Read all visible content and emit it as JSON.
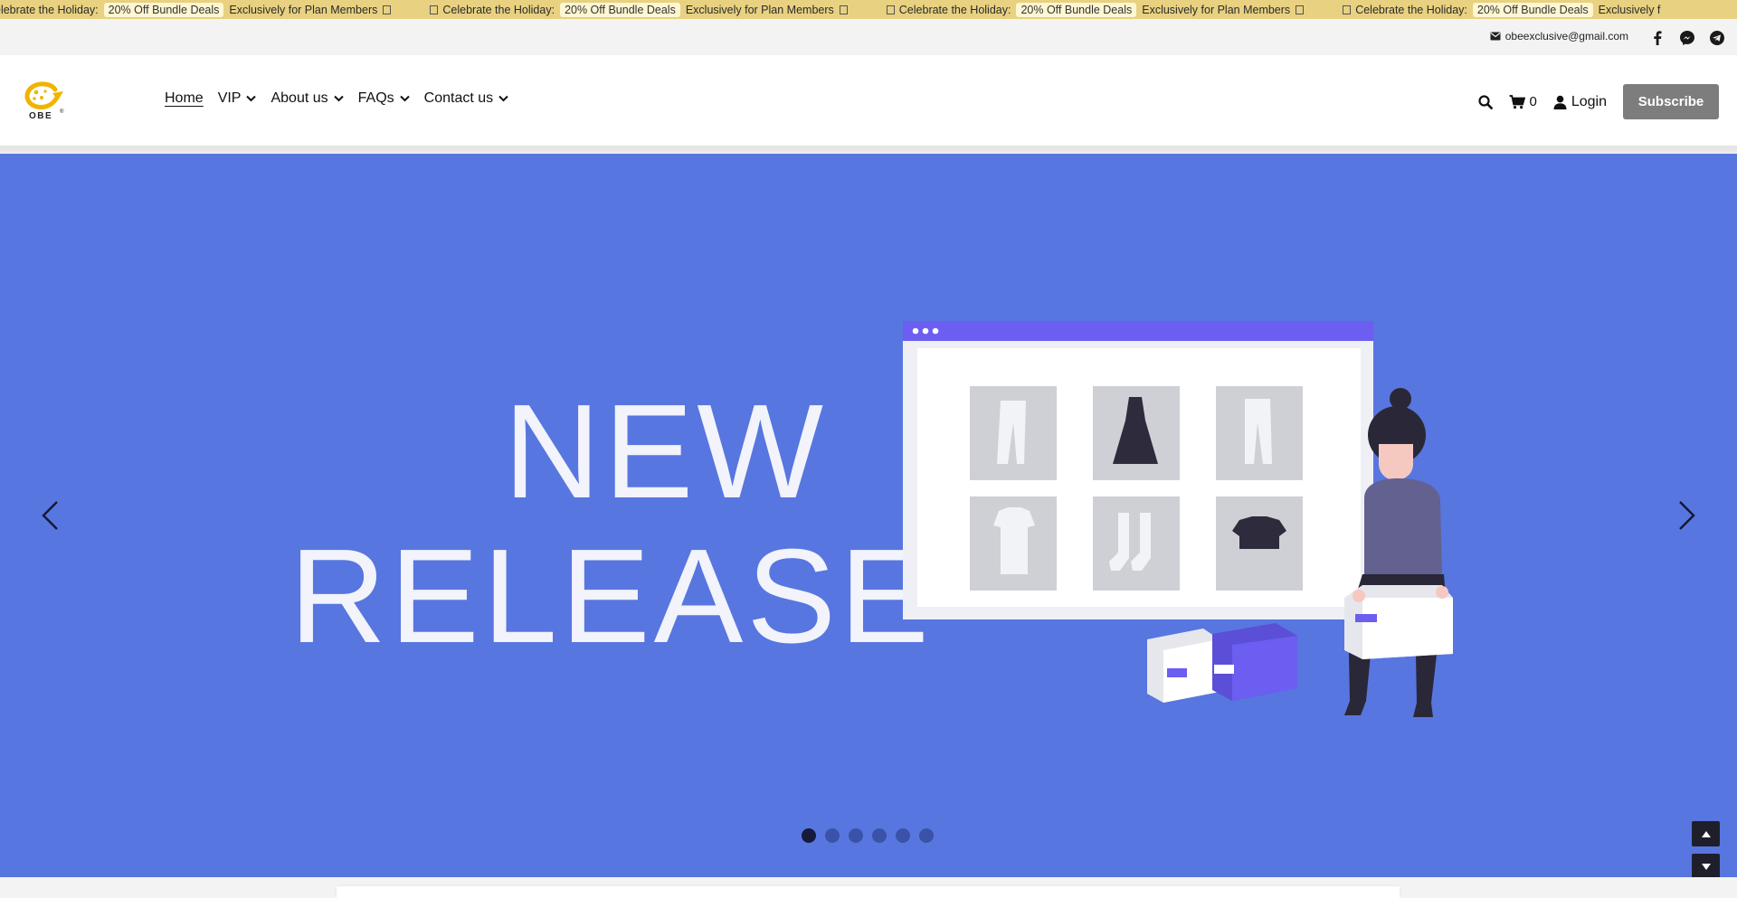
{
  "announcement": {
    "items": [
      {
        "prefix": "elebrate the Holiday:",
        "badge": "20% Off Bundle Deals",
        "suffix": "Exclusively for Plan Members"
      },
      {
        "prefix": "Celebrate the Holiday:",
        "badge": "20% Off Bundle Deals",
        "suffix": "Exclusively for Plan Members"
      },
      {
        "prefix": "Celebrate the Holiday:",
        "badge": "20% Off Bundle Deals",
        "suffix": "Exclusively for Plan Members"
      },
      {
        "prefix": "Celebrate the Holiday:",
        "badge": "20% Off Bundle Deals",
        "suffix": "Exclusively f"
      }
    ],
    "background": "#e8d180"
  },
  "topbar": {
    "email": "obeexclusive@gmail.com",
    "social_icons": [
      "facebook-icon",
      "messenger-icon",
      "telegram-icon"
    ]
  },
  "header": {
    "logo_text": "OBE",
    "nav": [
      {
        "label": "Home",
        "active": true,
        "dropdown": false
      },
      {
        "label": "VIP",
        "active": false,
        "dropdown": true
      },
      {
        "label": "About us",
        "active": false,
        "dropdown": true
      },
      {
        "label": "FAQs",
        "active": false,
        "dropdown": true
      },
      {
        "label": "Contact us",
        "active": false,
        "dropdown": true
      }
    ],
    "cart_count": "0",
    "login_label": "Login",
    "subscribe_label": "Subscribe"
  },
  "hero": {
    "line1": "NEW",
    "line2": "RELEASE",
    "background": "#5876e0",
    "slides_total": 6,
    "active_slide": 1
  }
}
